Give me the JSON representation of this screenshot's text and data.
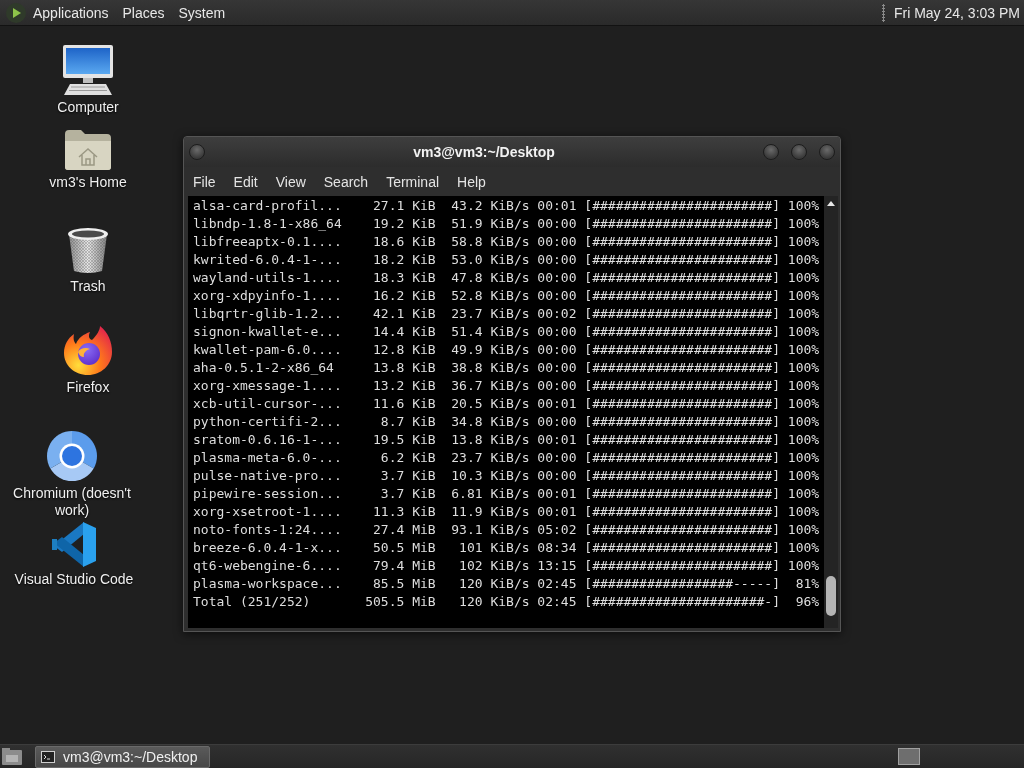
{
  "top_panel": {
    "menus": [
      "Applications",
      "Places",
      "System"
    ],
    "clock": "Fri May 24, 3:03 PM"
  },
  "desktop_icons": [
    {
      "kind": "computer",
      "label": "Computer"
    },
    {
      "kind": "home",
      "label": "vm3's Home"
    },
    {
      "kind": "trash",
      "label": "Trash"
    },
    {
      "kind": "fox",
      "label": "Firefox"
    },
    {
      "kind": "ring",
      "label": "Chromium (doesn't work)"
    },
    {
      "kind": "ribbon",
      "label": "Visual Studio Code"
    }
  ],
  "window": {
    "title": "vm3@vm3:~/Desktop",
    "menu": [
      "File",
      "Edit",
      "View",
      "Search",
      "Terminal",
      "Help"
    ],
    "lines": [
      "alsa-card-profil...    27.1 KiB  43.2 KiB/s 00:01 [#######################] 100%",
      "libndp-1.8-1-x86_64    19.2 KiB  51.9 KiB/s 00:00 [#######################] 100%",
      "libfreeaptx-0.1....    18.6 KiB  58.8 KiB/s 00:00 [#######################] 100%",
      "kwrited-6.0.4-1-...    18.2 KiB  53.0 KiB/s 00:00 [#######################] 100%",
      "wayland-utils-1....    18.3 KiB  47.8 KiB/s 00:00 [#######################] 100%",
      "xorg-xdpyinfo-1....    16.2 KiB  52.8 KiB/s 00:00 [#######################] 100%",
      "libqrtr-glib-1.2...    42.1 KiB  23.7 KiB/s 00:02 [#######################] 100%",
      "signon-kwallet-e...    14.4 KiB  51.4 KiB/s 00:00 [#######################] 100%",
      "kwallet-pam-6.0....    12.8 KiB  49.9 KiB/s 00:00 [#######################] 100%",
      "aha-0.5.1-2-x86_64     13.8 KiB  38.8 KiB/s 00:00 [#######################] 100%",
      "xorg-xmessage-1....    13.2 KiB  36.7 KiB/s 00:00 [#######################] 100%",
      "xcb-util-cursor-...    11.6 KiB  20.5 KiB/s 00:01 [#######################] 100%",
      "python-certifi-2...     8.7 KiB  34.8 KiB/s 00:00 [#######################] 100%",
      "sratom-0.6.16-1-...    19.5 KiB  13.8 KiB/s 00:01 [#######################] 100%",
      "plasma-meta-6.0-...     6.2 KiB  23.7 KiB/s 00:00 [#######################] 100%",
      "pulse-native-pro...     3.7 KiB  10.3 KiB/s 00:00 [#######################] 100%",
      "pipewire-session...     3.7 KiB  6.81 KiB/s 00:01 [#######################] 100%",
      "xorg-xsetroot-1....    11.3 KiB  11.9 KiB/s 00:01 [#######################] 100%",
      "noto-fonts-1:24....    27.4 MiB  93.1 KiB/s 05:02 [#######################] 100%",
      "breeze-6.0.4-1-x...    50.5 MiB   101 KiB/s 08:34 [#######################] 100%",
      "qt6-webengine-6....    79.4 MiB   102 KiB/s 13:15 [#######################] 100%",
      "plasma-workspace...    85.5 MiB   120 KiB/s 02:45 [##################-----]  81%",
      "Total (251/252)       505.5 MiB   120 KiB/s 02:45 [######################-]  96%"
    ]
  },
  "bottom_panel": {
    "tasks": [
      {
        "label": "vm3@vm3:~/Desktop",
        "selected": true
      }
    ]
  }
}
